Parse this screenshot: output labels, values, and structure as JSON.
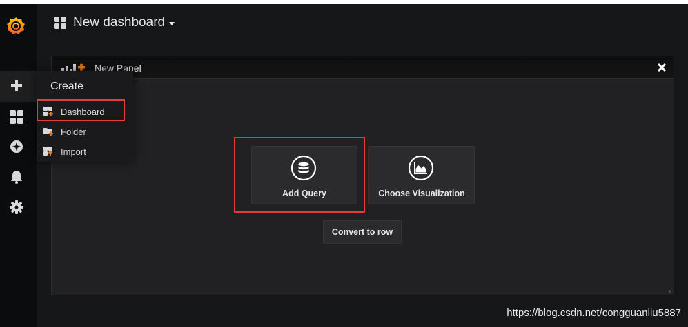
{
  "topnav": {
    "dashboard_title": "New dashboard"
  },
  "sidemenu": {
    "items": [
      {
        "icon": "grafana-logo-icon"
      },
      {
        "icon": "plus-icon"
      },
      {
        "icon": "dashboards-grid-icon"
      },
      {
        "icon": "compass-icon"
      },
      {
        "icon": "bell-icon"
      },
      {
        "icon": "gear-icon"
      }
    ]
  },
  "create_menu": {
    "title": "Create",
    "items": [
      {
        "label": "Dashboard",
        "icon": "dashboard-plus-icon"
      },
      {
        "label": "Folder",
        "icon": "folder-plus-icon"
      },
      {
        "label": "Import",
        "icon": "import-icon"
      }
    ]
  },
  "panel": {
    "title": "New Panel",
    "options": [
      {
        "label": "Add Query",
        "icon": "database-icon"
      },
      {
        "label": "Choose Visualization",
        "icon": "area-chart-icon"
      }
    ],
    "convert_label": "Convert to row"
  },
  "watermark": "https://blog.csdn.net/congguanliu5887",
  "colors": {
    "accent_orange": "#eb7b18",
    "highlight_red": "#e53b3b",
    "background": "#161719",
    "panel": "#212124"
  }
}
